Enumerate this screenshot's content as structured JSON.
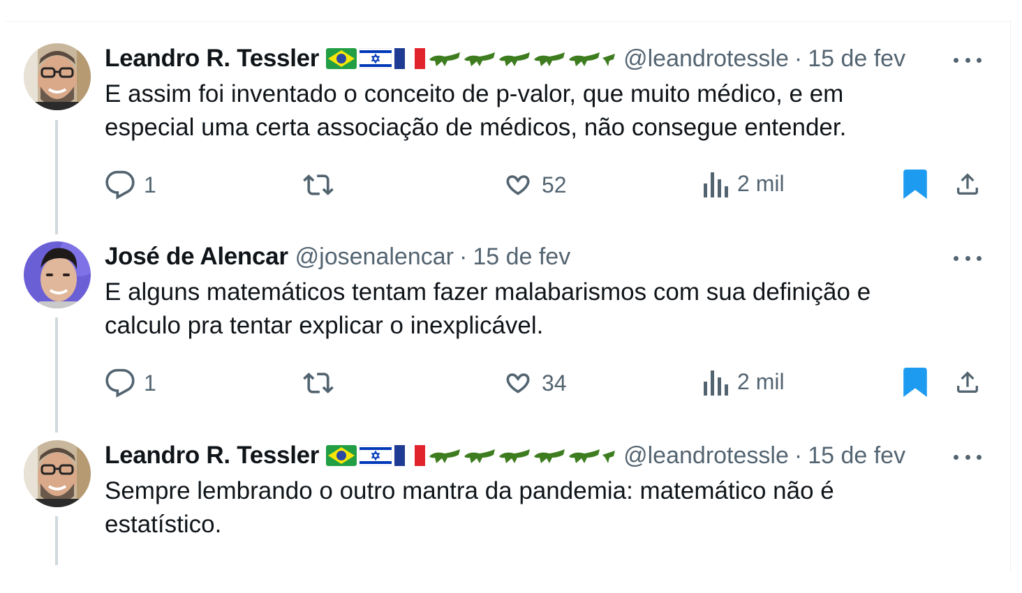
{
  "tweets": [
    {
      "author": "Leandro R. Tessler",
      "handle": "@leandrotessle",
      "separator": "·",
      "date": "15 de fev",
      "text": "E assim foi inventado o conceito de p-valor, que muito médico, e em especial uma certa associação de médicos, não consegue entender.",
      "replies": "1",
      "likes": "52",
      "views": "2 mil",
      "bookmarked": true
    },
    {
      "author": "José de Alencar",
      "handle": "@josenalencar",
      "separator": "·",
      "date": "15 de fev",
      "text": "E alguns matemáticos tentam fazer malabarismos com sua definição e calculo pra tentar explicar o inexplicável.",
      "replies": "1",
      "likes": "34",
      "views": "2 mil",
      "bookmarked": true
    },
    {
      "author": "Leandro R. Tessler",
      "handle": "@leandrotessle",
      "separator": "·",
      "date": "15 de fev",
      "text": "Sempre lembrando o outro mantra da pandemia: matemático não é estatístico."
    }
  ],
  "colors": {
    "bookmark": "#1d9bf0",
    "secondary_text": "#536471",
    "thread_line": "#cfd9de",
    "croc": "#3e7d1f"
  },
  "icons": [
    "reply-icon",
    "retweet-icon",
    "like-icon",
    "views-icon",
    "bookmark-icon",
    "share-icon",
    "more-icon",
    "brazil-flag-icon",
    "israel-flag-icon",
    "france-flag-icon",
    "crocodile-icon"
  ]
}
